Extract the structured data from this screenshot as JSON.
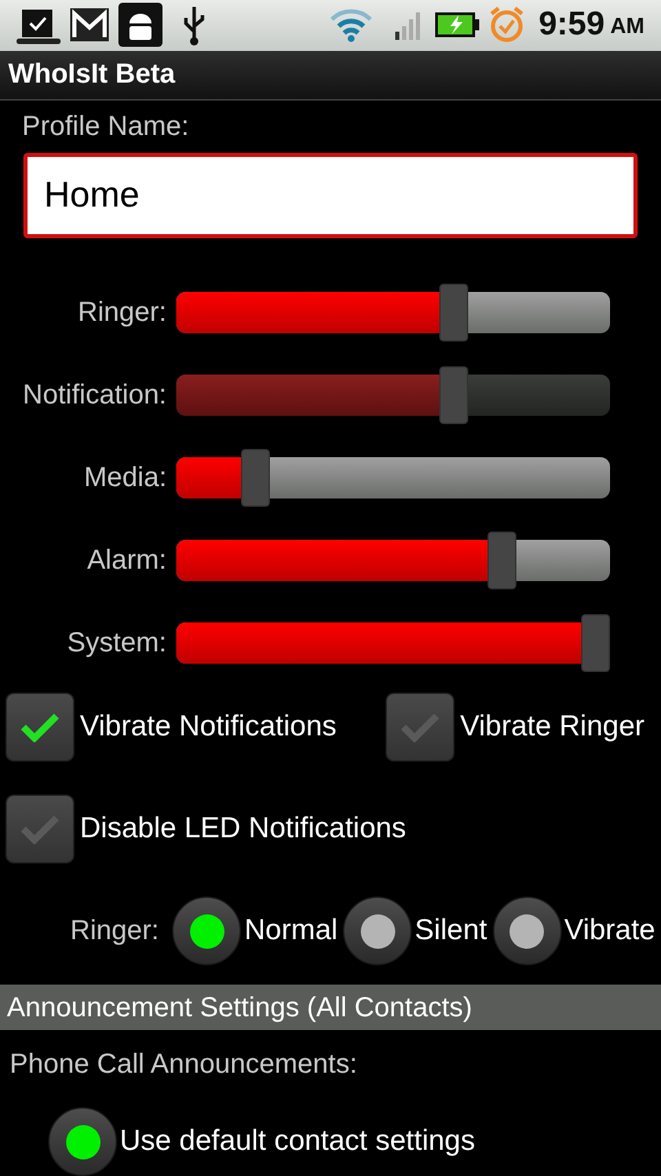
{
  "status_bar": {
    "time": "9:59",
    "meridiem": "AM"
  },
  "app_title": "WhoIsIt Beta",
  "profile": {
    "label": "Profile Name:",
    "value": "Home"
  },
  "volume_sliders": [
    {
      "label": "Ringer:",
      "level": 0.65,
      "disabled": false
    },
    {
      "label": "Notification:",
      "level": 0.65,
      "disabled": true
    },
    {
      "label": "Media:",
      "level": 0.16,
      "disabled": false
    },
    {
      "label": "Alarm:",
      "level": 0.77,
      "disabled": false
    },
    {
      "label": "System:",
      "level": 1.0,
      "disabled": false
    }
  ],
  "checkboxes": [
    {
      "label": "Vibrate Notifications",
      "checked": true
    },
    {
      "label": "Vibrate Ringer",
      "checked": false
    },
    {
      "label": "Disable LED Notifications",
      "checked": false
    }
  ],
  "ringer_mode": {
    "label": "Ringer:",
    "options": [
      {
        "label": "Normal",
        "selected": true
      },
      {
        "label": "Silent",
        "selected": false
      },
      {
        "label": "Vibrate",
        "selected": false
      }
    ]
  },
  "section_header": "Announcement Settings (All Contacts)",
  "phone_call": {
    "label": "Phone Call Announcements:",
    "options": [
      {
        "label": "Use default contact settings",
        "selected": true
      }
    ]
  }
}
